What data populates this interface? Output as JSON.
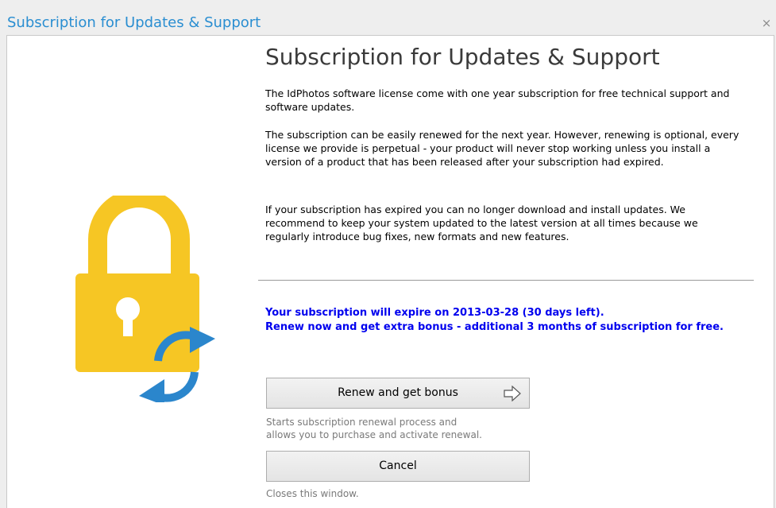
{
  "window": {
    "title": "Subscription for Updates & Support",
    "close_glyph": "×"
  },
  "content": {
    "heading": "Subscription for Updates & Support",
    "paragraphs": [
      "The IdPhotos software license come with one year subscription for free technical support and software updates.",
      "The subscription can be easily renewed for the next year. However, renewing is optional, every license we provide is perpetual - your product will never stop working unless you install a version of a product that has been released after your subscription had expired.",
      "If your subscription has expired you can no longer download and install updates. We recommend to keep your system updated to the latest version at all times because we regularly introduce bug fixes, new formats and new features."
    ],
    "notice_line1": "Your subscription will expire on 2013-03-28 (30 days left).",
    "notice_line2": "Renew now and get extra bonus - additional 3 months of subscription for free."
  },
  "buttons": {
    "renew_label": "Renew and get bonus",
    "renew_hint_line1": "Starts subscription renewal process and",
    "renew_hint_line2": "allows you to purchase and activate renewal.",
    "cancel_label": "Cancel",
    "cancel_hint": "Closes this window."
  },
  "icons": {
    "main": "lock-refresh-icon",
    "renew_arrow": "arrow-right-icon"
  },
  "colors": {
    "title": "#2a8ed1",
    "notice": "#0000ee",
    "lock_body": "#f6c624",
    "refresh": "#2b86cc"
  }
}
